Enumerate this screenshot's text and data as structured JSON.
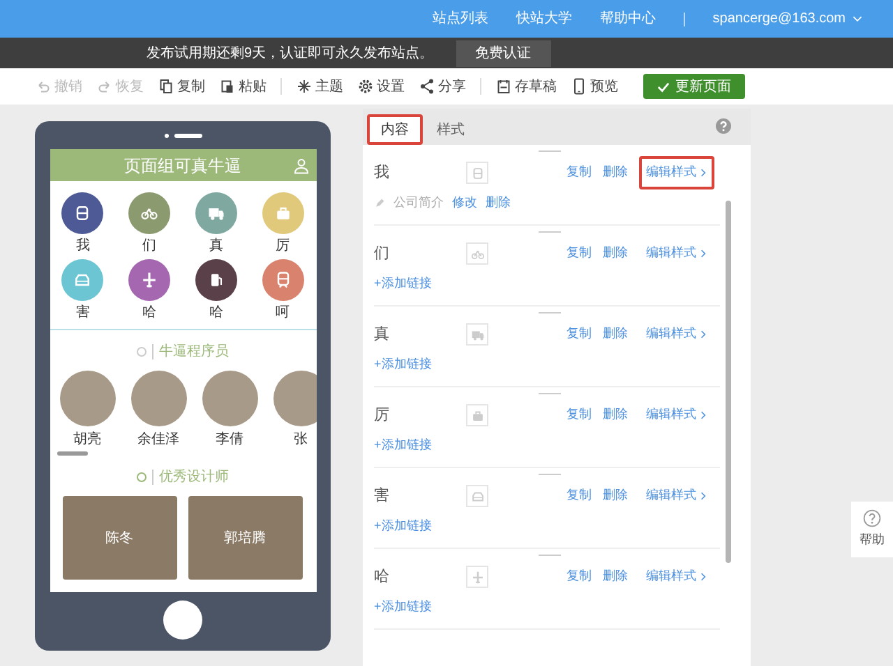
{
  "top_nav": {
    "links": [
      "站点列表",
      "快站大学",
      "帮助中心"
    ],
    "account": "spancerge@163.com"
  },
  "notice": {
    "text": "发布试用期还剩9天，认证即可永久发布站点。",
    "button": "免费认证"
  },
  "toolbar": [
    {
      "kind": "undo",
      "label": "撤销",
      "disabled": true
    },
    {
      "kind": "redo",
      "label": "恢复",
      "disabled": true
    },
    {
      "kind": "copy",
      "label": "复制",
      "disabled": false
    },
    {
      "kind": "paste",
      "label": "粘贴",
      "disabled": false
    },
    {
      "kind": "theme",
      "label": "主题",
      "disabled": false
    },
    {
      "kind": "settings",
      "label": "设置",
      "disabled": false
    },
    {
      "kind": "share",
      "label": "分享",
      "disabled": false
    },
    {
      "kind": "draft",
      "label": "存草稿",
      "disabled": false
    },
    {
      "kind": "preview",
      "label": "预览",
      "disabled": false
    }
  ],
  "publish_button": "更新页面",
  "phone": {
    "title": "页面组可真牛逼",
    "grid": [
      {
        "label": "我",
        "color": "#4e5a96"
      },
      {
        "label": "们",
        "color": "#8c9a70"
      },
      {
        "label": "真",
        "color": "#7fa9a0"
      },
      {
        "label": "厉",
        "color": "#e0c97a"
      },
      {
        "label": "害",
        "color": "#6cc5d3"
      },
      {
        "label": "哈",
        "color": "#a467b0"
      },
      {
        "label": "哈",
        "color": "#5a4048"
      },
      {
        "label": "呵",
        "color": "#d9826e"
      }
    ],
    "section_1": {
      "title": "牛逼程序员",
      "people": [
        "胡亮",
        "余佳泽",
        "李倩",
        "张"
      ]
    },
    "section_2": {
      "title": "优秀设计师",
      "cards": [
        "陈冬",
        "郭培腾"
      ]
    }
  },
  "panel": {
    "tabs": [
      {
        "label": "内容",
        "selected": true,
        "highlighted": true
      },
      {
        "label": "样式",
        "selected": false,
        "highlighted": false
      }
    ],
    "rows": [
      {
        "label": "我",
        "actions": [
          "复制",
          "删除",
          "编辑样式"
        ],
        "highlighted": true,
        "sub": {
          "text": "公司简介",
          "actions": [
            "修改",
            "删除"
          ]
        }
      },
      {
        "label": "们",
        "actions": [
          "复制",
          "删除",
          "编辑样式"
        ],
        "highlighted": false,
        "add_link": "+添加链接"
      },
      {
        "label": "真",
        "actions": [
          "复制",
          "删除",
          "编辑样式"
        ],
        "highlighted": false,
        "add_link": "+添加链接"
      },
      {
        "label": "厉",
        "actions": [
          "复制",
          "删除",
          "编辑样式"
        ],
        "highlighted": false,
        "add_link": "+添加链接"
      },
      {
        "label": "害",
        "actions": [
          "复制",
          "删除",
          "编辑样式"
        ],
        "highlighted": false,
        "add_link": "+添加链接"
      },
      {
        "label": "哈",
        "actions": [
          "复制",
          "删除",
          "编辑样式"
        ],
        "highlighted": false,
        "add_link": "+添加链接"
      }
    ]
  },
  "help_button": "帮助"
}
